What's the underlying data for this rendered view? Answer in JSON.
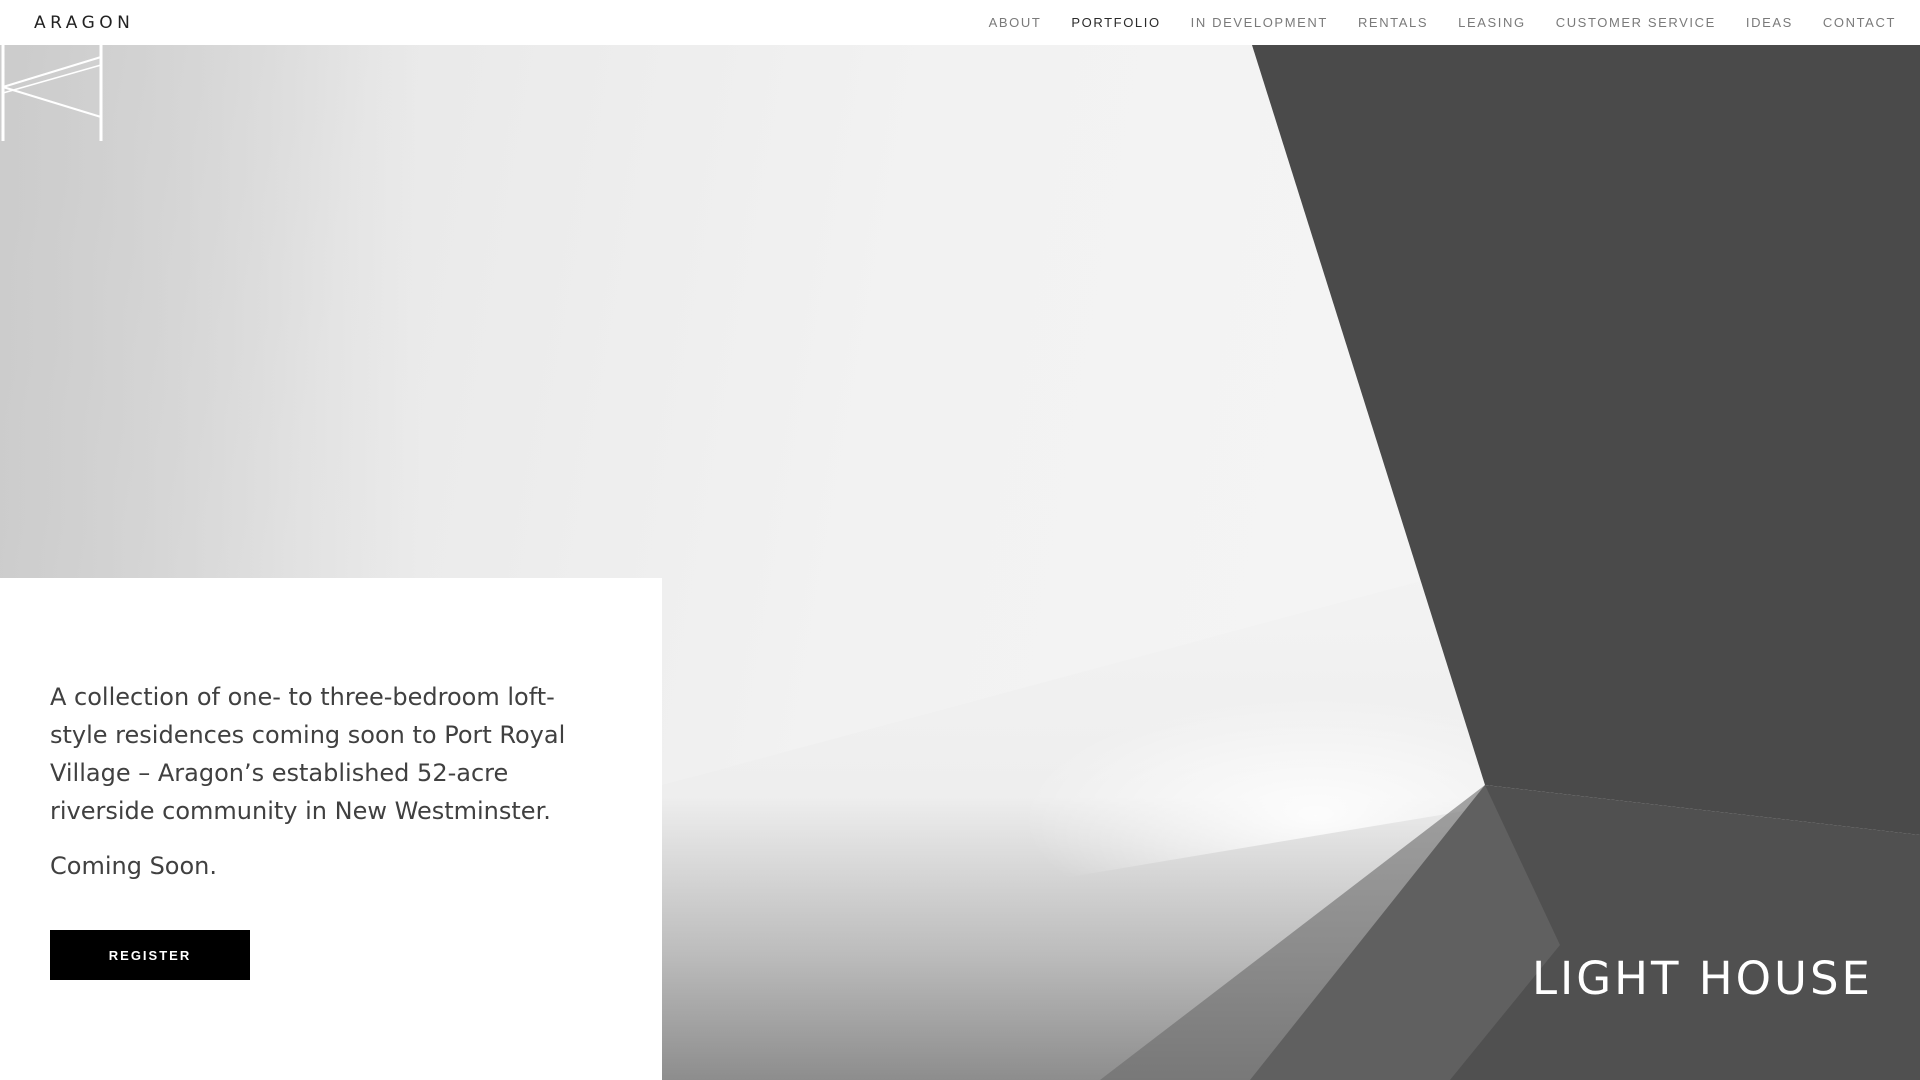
{
  "brand": {
    "logo_text": "ARAGON"
  },
  "nav": {
    "items": [
      {
        "label": "ABOUT",
        "active": false
      },
      {
        "label": "PORTFOLIO",
        "active": true
      },
      {
        "label": "IN DEVELOPMENT",
        "active": false
      },
      {
        "label": "RENTALS",
        "active": false
      },
      {
        "label": "LEASING",
        "active": false
      },
      {
        "label": "CUSTOMER SERVICE",
        "active": false
      },
      {
        "label": "IDEAS",
        "active": false
      },
      {
        "label": "CONTACT",
        "active": false
      }
    ]
  },
  "hero": {
    "project_title": "LIGHT HOUSE",
    "mark_icon": "lighthouse-monogram-icon"
  },
  "card": {
    "description": "A collection of one- to three-bedroom loft-style residences coming soon to Port Royal Village – Aragon’s established 52-acre riverside community in New Westminster.",
    "status": "Coming Soon.",
    "register_label": "REGISTER"
  },
  "colors": {
    "dark_panel": "#4a4a4a",
    "light_wall": "#f3f3f3",
    "button_bg": "#000000",
    "button_text": "#ffffff",
    "nav_text": "#7a7a7a",
    "nav_active": "#2a2a2a"
  }
}
